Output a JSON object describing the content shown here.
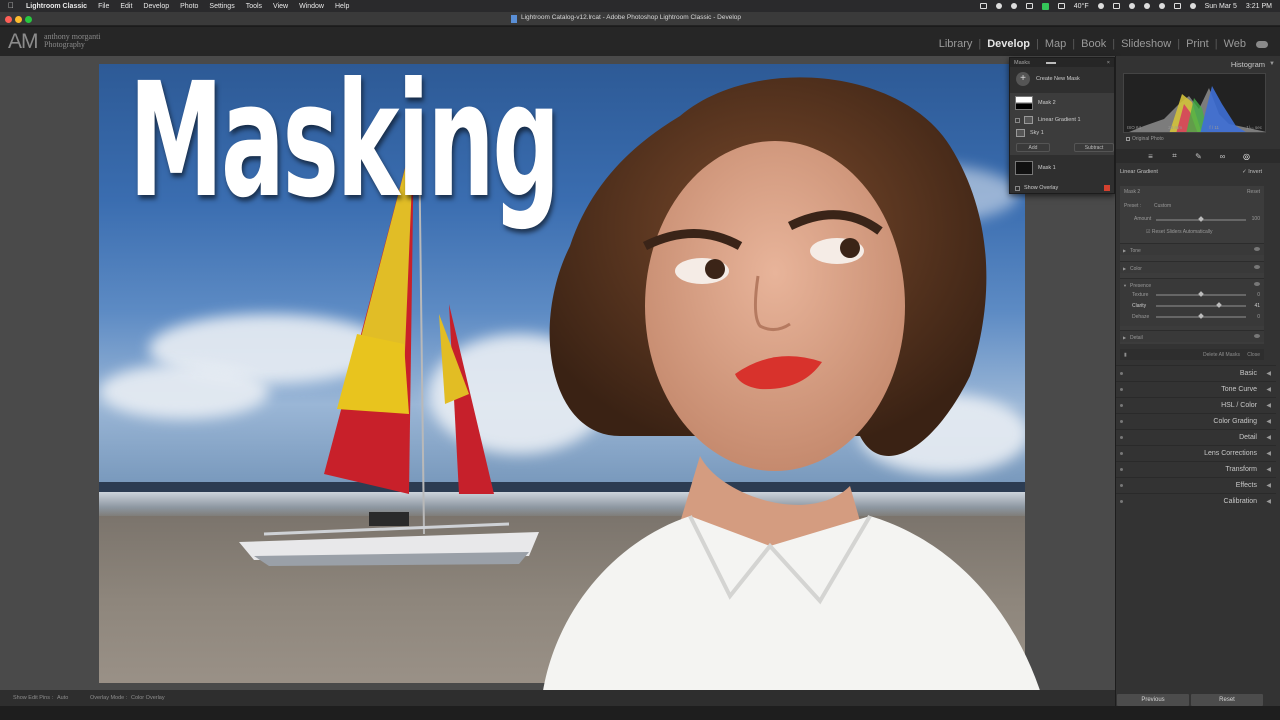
{
  "menubar": {
    "items": [
      "Lightroom Classic",
      "File",
      "Edit",
      "Develop",
      "Photo",
      "Settings",
      "Tools",
      "View",
      "Window",
      "Help"
    ],
    "weather": "40°F",
    "date": "Sun Mar 5",
    "time": "3:21 PM"
  },
  "window": {
    "title": "Lightroom Catalog-v12.lrcat - Adobe Photoshop Lightroom Classic - Develop"
  },
  "identity": {
    "initials": "AM",
    "name_line1": "anthony morganti",
    "name_line2": "Photography"
  },
  "modules": [
    "Library",
    "Develop",
    "Map",
    "Book",
    "Slideshow",
    "Print",
    "Web"
  ],
  "active_module": "Develop",
  "overlay_text": "Masking",
  "masks_panel": {
    "title": "Masks",
    "create_new": "Create New Mask",
    "mask2": "Mask 2",
    "linear_gradient": "Linear Gradient 1",
    "sky": "Sky 1",
    "add": "Add",
    "subtract": "Subtract",
    "mask1": "Mask 1",
    "show_overlay": "Show Overlay"
  },
  "histogram": {
    "title": "Histogram",
    "iso": "ISO 64",
    "focal": "24 mm",
    "aperture": "f / 11",
    "shutter": "1/₆₀ sec",
    "original_photo": "Original Photo"
  },
  "mask_settings": {
    "type": "Linear Gradient",
    "invert": "Invert",
    "mask_name": "Mask 2",
    "reset": "Reset",
    "preset_label": "Preset :",
    "preset_value": "Custom",
    "amount_label": "Amount",
    "amount_value": "100",
    "reset_sliders": "Reset Sliders Automatically",
    "tone": "Tone",
    "color": "Color",
    "presence": "Presence",
    "texture_label": "Texture",
    "texture_value": "0",
    "clarity_label": "Clarity",
    "clarity_value": "41",
    "dehaze_label": "Dehaze",
    "dehaze_value": "0",
    "detail": "Detail",
    "delete_all": "Delete All Masks",
    "close": "Close"
  },
  "sliders": {
    "amount": 1.0,
    "texture": 0.0,
    "clarity": 0.41,
    "dehaze": 0.0
  },
  "sections": [
    "Basic",
    "Tone Curve",
    "HSL / Color",
    "Color Grading",
    "Detail",
    "Lens Corrections",
    "Transform",
    "Effects",
    "Calibration"
  ],
  "toolbar": {
    "edit_pins_label": "Show Edit Pins :",
    "edit_pins_value": "Auto",
    "overlay_mode_label": "Overlay Mode :",
    "overlay_mode_value": "Color Overlay"
  },
  "footer": {
    "previous": "Previous",
    "reset": "Reset"
  },
  "colors": {
    "overlay_swatch": "#d4412f",
    "panel_bg": "#333333",
    "workspace_bg": "#4a4a4a"
  }
}
